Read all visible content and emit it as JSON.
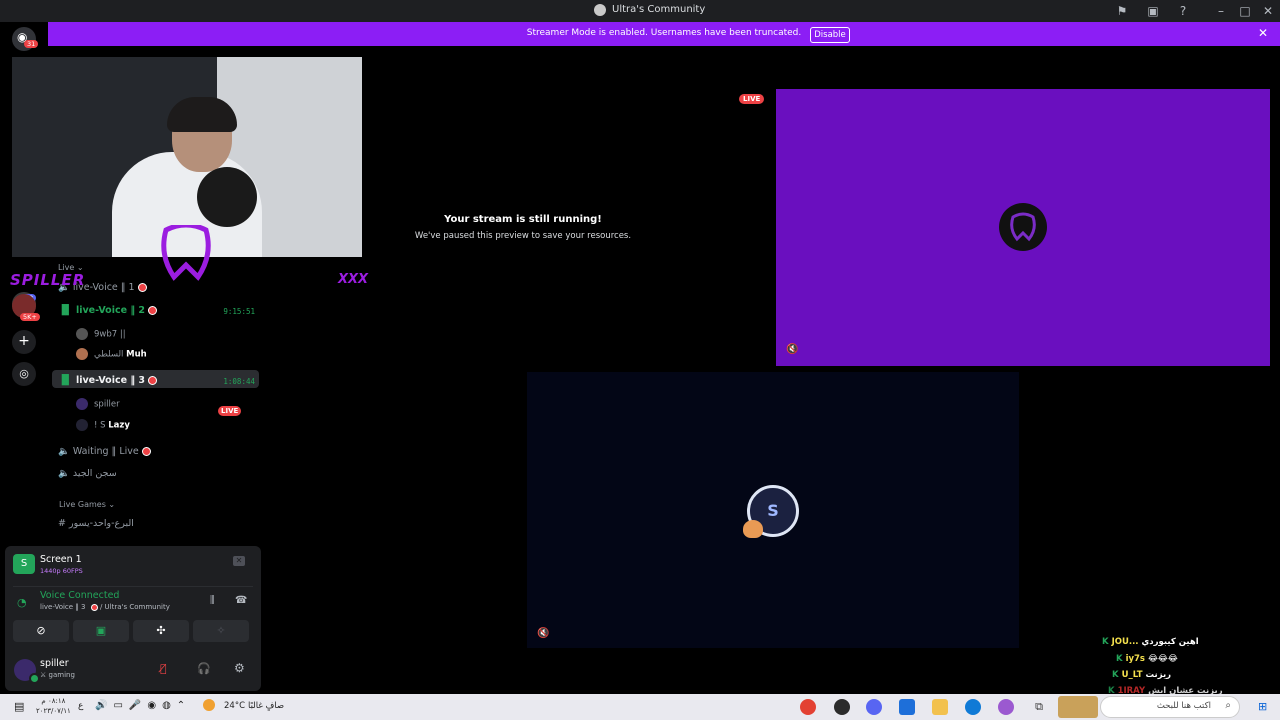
{
  "window": {
    "title": "Ultra's Community"
  },
  "banner": {
    "message": "Streamer Mode is enabled. Usernames have been truncated.",
    "button": "Disable"
  },
  "rail": {
    "badge_count": "31",
    "member_badge": "5K+",
    "server_count": "22"
  },
  "overlay": {
    "name_left": "SPILLER",
    "name_right": "XXX"
  },
  "channels": {
    "live_category": "Live",
    "voice1": {
      "label": "live-Voice ‖ 1"
    },
    "voice2": {
      "label": "live-Voice ‖ 2",
      "timer": "9:15:51",
      "users": [
        {
          "name": "9wb7 ||"
        },
        {
          "name": "السلطي",
          "tag": "Muh"
        }
      ]
    },
    "voice3": {
      "label": "live-Voice ‖ 3",
      "timer": "1:08:44",
      "users": [
        {
          "name": "spiller",
          "badge": "LIVE"
        },
        {
          "name": "! S",
          "tag": "Lazy"
        }
      ]
    },
    "waiting": {
      "label": "Waiting ‖ Live"
    },
    "jail": {
      "label": "سجن الجيد"
    },
    "games_category": "Live Games",
    "text1": {
      "label": "البرع-واحد-يسور"
    }
  },
  "panel": {
    "screen": {
      "title": "Screen 1",
      "quality": "1440p 60FPS"
    },
    "voice": {
      "status": "Voice Connected",
      "channel": "live-Voice ‖ 3",
      "server": "/ Ultra's Community"
    },
    "user": {
      "name": "spiller",
      "status": "gaming"
    }
  },
  "stream": {
    "paused_title": "Your stream is still running!",
    "paused_sub": "We've paused this preview to save your resources.",
    "live_badge": "LIVE"
  },
  "chat": [
    {
      "user": "JOU...",
      "text": "اهين كيبوردي"
    },
    {
      "user": "iy7s",
      "text": "😂😂😂"
    },
    {
      "user": "U_LT",
      "text": "ريزنت"
    },
    {
      "user": "1IRAY",
      "text": "ريزنت عشان ايش"
    },
    {
      "user": "1IRAY",
      "text": ""
    }
  ],
  "taskbar": {
    "search_placeholder": "اكتب هنا للبحث",
    "weather_temp": "24°C",
    "weather_desc": "صافٍ غالبًا",
    "time": "٠٨:١٨ م",
    "date": "٢٠٢٣/٠٧/١١",
    "lang": "ع"
  },
  "colors": {
    "accent": "#8c1ef5",
    "green": "#23a55a",
    "red": "#ed4245",
    "tile_purple": "#6a0fbf"
  }
}
